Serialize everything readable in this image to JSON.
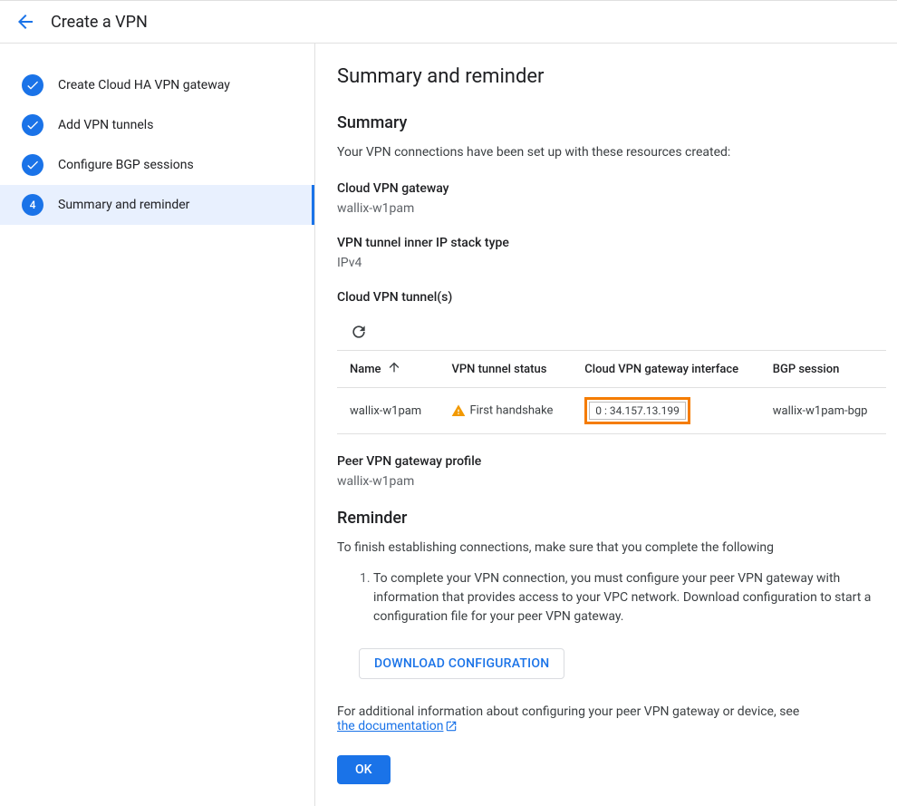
{
  "header": {
    "title": "Create a VPN"
  },
  "sidebar": {
    "steps": [
      {
        "label": "Create Cloud HA VPN gateway",
        "done": true
      },
      {
        "label": "Add VPN tunnels",
        "done": true
      },
      {
        "label": "Configure BGP sessions",
        "done": true
      },
      {
        "label": "Summary and reminder",
        "done": false,
        "number": "4",
        "active": true
      }
    ]
  },
  "main": {
    "title": "Summary and reminder",
    "summary_heading": "Summary",
    "summary_desc": "Your VPN connections have been set up with these resources created:",
    "gateway_label": "Cloud VPN gateway",
    "gateway_value": "wallix-w1pam",
    "stack_label": "VPN tunnel inner IP stack type",
    "stack_value": "IPv4",
    "tunnels_label": "Cloud VPN tunnel(s)",
    "table": {
      "cols": {
        "name": "Name",
        "status": "VPN tunnel status",
        "iface": "Cloud VPN gateway interface",
        "bgp": "BGP session"
      },
      "rows": [
        {
          "name": "wallix-w1pam",
          "status": "First handshake",
          "iface": "0 : 34.157.13.199",
          "bgp": "wallix-w1pam-bgp"
        }
      ]
    },
    "peer_label": "Peer VPN gateway profile",
    "peer_value": "wallix-w1pam",
    "reminder_heading": "Reminder",
    "reminder_desc": "To finish establishing connections, make sure that you complete the following",
    "reminder_item": "To complete your VPN connection, you must configure your peer VPN gateway with information that provides access to your VPC network. Download configuration to start a configuration file for your peer VPN gateway.",
    "download_btn": "DOWNLOAD CONFIGURATION",
    "footnote_prefix": "For additional information about configuring your peer VPN gateway or device, see ",
    "footnote_link": "the documentation",
    "ok_btn": "OK"
  }
}
